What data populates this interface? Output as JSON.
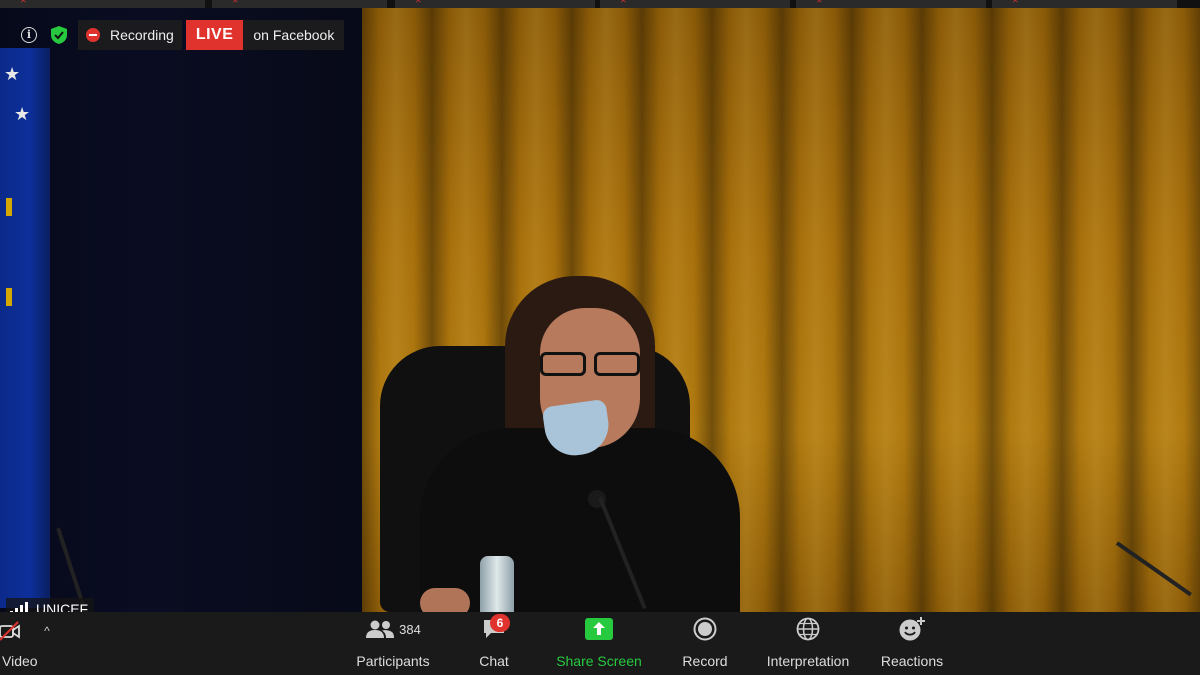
{
  "overlay": {
    "recording_label": "Recording",
    "live_badge": "LIVE",
    "live_destination": "on Facebook"
  },
  "speaker": {
    "name": "UNICEF"
  },
  "toolbar": {
    "video_label": "Video",
    "participants_label": "Participants",
    "participants_count": "384",
    "chat_label": "Chat",
    "chat_badge": "6",
    "share_label": "Share Screen",
    "record_label": "Record",
    "interpretation_label": "Interpretation",
    "reactions_label": "Reactions"
  },
  "colors": {
    "live_red": "#e0332d",
    "share_green": "#27c93f",
    "toolbar_bg": "#1a1a1a"
  },
  "icons": {
    "info": "info-icon",
    "security": "shield-check-icon",
    "recording": "record-dot-icon",
    "signal": "signal-bars-icon",
    "video_off": "video-off-icon",
    "participants": "people-icon",
    "chat": "chat-bubble-icon",
    "share": "share-screen-icon",
    "record": "record-icon",
    "interpretation": "globe-icon",
    "reactions": "emoji-plus-icon"
  }
}
